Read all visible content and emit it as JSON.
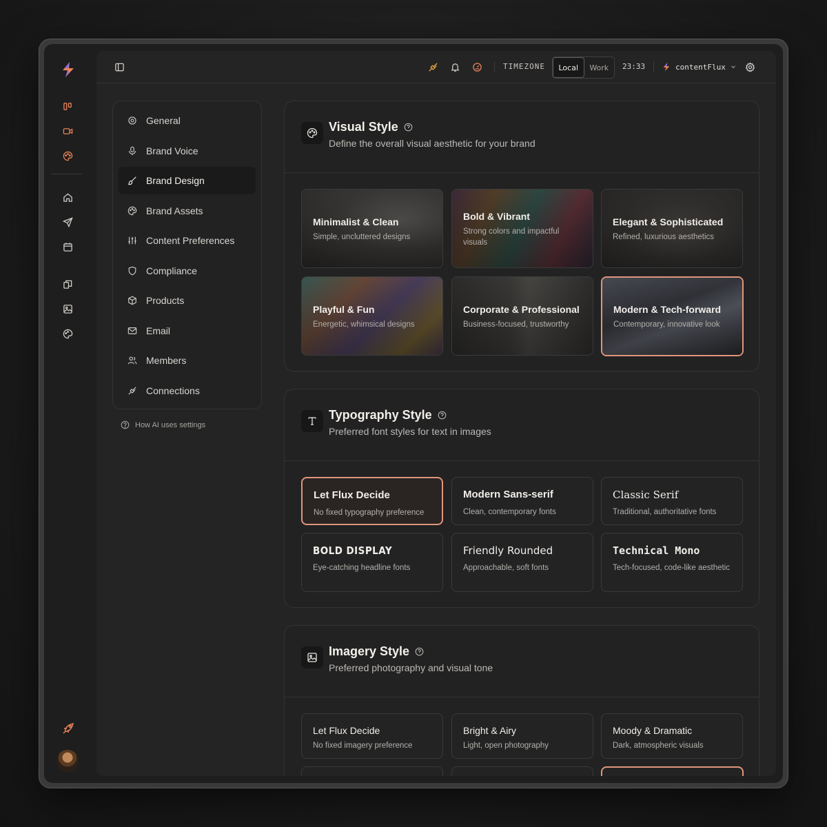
{
  "topbar": {
    "timezone_label": "TIMEZONE",
    "tz_local": "Local",
    "tz_work": "Work",
    "clock": "23:33",
    "workspace_name": "contentFlux"
  },
  "nav": {
    "items": [
      {
        "label": "General",
        "icon": "gear-icon"
      },
      {
        "label": "Brand Voice",
        "icon": "microphone-icon"
      },
      {
        "label": "Brand Design",
        "icon": "brush-icon"
      },
      {
        "label": "Brand Assets",
        "icon": "palette-icon"
      },
      {
        "label": "Content Preferences",
        "icon": "sliders-icon"
      },
      {
        "label": "Compliance",
        "icon": "shield-icon"
      },
      {
        "label": "Products",
        "icon": "box-icon"
      },
      {
        "label": "Email",
        "icon": "mail-icon"
      },
      {
        "label": "Members",
        "icon": "users-icon"
      },
      {
        "label": "Connections",
        "icon": "plug-icon"
      }
    ],
    "active": "Brand Design",
    "help_link": "How AI uses settings"
  },
  "visual_style": {
    "title": "Visual Style",
    "subtitle": "Define the overall visual aesthetic for your brand",
    "options": [
      {
        "title": "Minimalist & Clean",
        "desc": "Simple, uncluttered designs"
      },
      {
        "title": "Bold & Vibrant",
        "desc": "Strong colors and impactful visuals"
      },
      {
        "title": "Elegant & Sophisticated",
        "desc": "Refined, luxurious aesthetics"
      },
      {
        "title": "Playful & Fun",
        "desc": "Energetic, whimsical designs"
      },
      {
        "title": "Corporate & Professional",
        "desc": "Business-focused, trustworthy"
      },
      {
        "title": "Modern & Tech-forward",
        "desc": "Contemporary, innovative look"
      }
    ],
    "selected": "Modern & Tech-forward"
  },
  "typography_style": {
    "title": "Typography Style",
    "subtitle": "Preferred font styles for text in images",
    "options": [
      {
        "title": "Let Flux Decide",
        "desc": "No fixed typography preference"
      },
      {
        "title": "Modern Sans-serif",
        "desc": "Clean, contemporary fonts"
      },
      {
        "title": "Classic Serif",
        "desc": "Traditional, authoritative fonts"
      },
      {
        "title": "BOLD DISPLAY",
        "desc": "Eye-catching headline fonts"
      },
      {
        "title": "Friendly Rounded",
        "desc": "Approachable, soft fonts"
      },
      {
        "title": "Technical Mono",
        "desc": "Tech-focused, code-like aesthetic"
      }
    ],
    "selected": "Let Flux Decide"
  },
  "imagery_style": {
    "title": "Imagery Style",
    "subtitle": "Preferred photography and visual tone",
    "options": [
      {
        "title": "Let Flux Decide",
        "desc": "No fixed imagery preference"
      },
      {
        "title": "Bright & Airy",
        "desc": "Light, open photography"
      },
      {
        "title": "Moody & Dramatic",
        "desc": "Dark, atmospheric visuals"
      }
    ]
  },
  "colors": {
    "accent": "#e1957c",
    "brand_orange": "#e8825a",
    "brand_purple": "#8b6cf0"
  }
}
